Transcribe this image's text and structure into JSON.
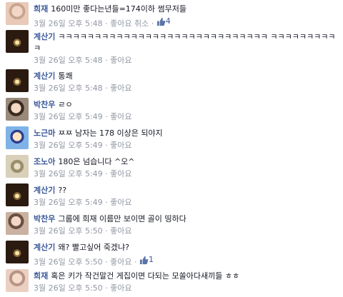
{
  "comments": [
    {
      "name": "희재",
      "text": "160미만 좋다는년들=174이하 썸무저들",
      "time": "3월 26일 오후 5:48",
      "like_label": "좋아요",
      "extra": "취소",
      "likes": "4"
    },
    {
      "name": "계산기",
      "text": "ㅋㅋㅋㅋㅋㅋㅋㅋㅋㅋㅋㅋㅋㅋㅋㅋㅋㅋㅋㅋㅋㅋㅋㅋㅋㅋㅋㅋㅋ ㅋㅋㅋㅋㅋㅋㅋㅋㅋㅋ",
      "time": "3월 26일 오후 5:48",
      "like_label": "좋아요"
    },
    {
      "name": "계산기",
      "text": "통쾌",
      "time": "3월 26일 오후 5:48",
      "like_label": "좋아요"
    },
    {
      "name": "박찬우",
      "text": "ㄹㅇ",
      "time": "3월 26일 오후 5:49",
      "like_label": "좋아요"
    },
    {
      "name": "노근마",
      "text": "ㅉㅉ 남자는 178 이상은 되야지",
      "time": "3월 26일 오후 5:49",
      "like_label": "좋아요"
    },
    {
      "name": "조노아",
      "text": "180은 넘습니다 ^오^",
      "time": "3월 26일 오후 5:49",
      "like_label": "좋아요"
    },
    {
      "name": "계산기",
      "text": "??",
      "time": "3월 26일 오후 5:49",
      "like_label": "좋아요"
    },
    {
      "name": "박찬우",
      "text": "그룹에 희재 이름만 보이면 골이 띵하다",
      "time": "3월 26일 오후 5:50",
      "like_label": "좋아요"
    },
    {
      "name": "계산기",
      "text": "왜? 빨고싶어 죽겠냐?",
      "time": "3월 26일 오후 5:50",
      "like_label": "좋아요",
      "likes": "1"
    },
    {
      "name": "희재",
      "text": "혹은 키가 작건말건 게집이면 다되는 모쏠아다새끼들 ㅎㅎ",
      "time": "3월 26일 오후 5:50",
      "like_label": "좋아요"
    }
  ],
  "separator": "·"
}
